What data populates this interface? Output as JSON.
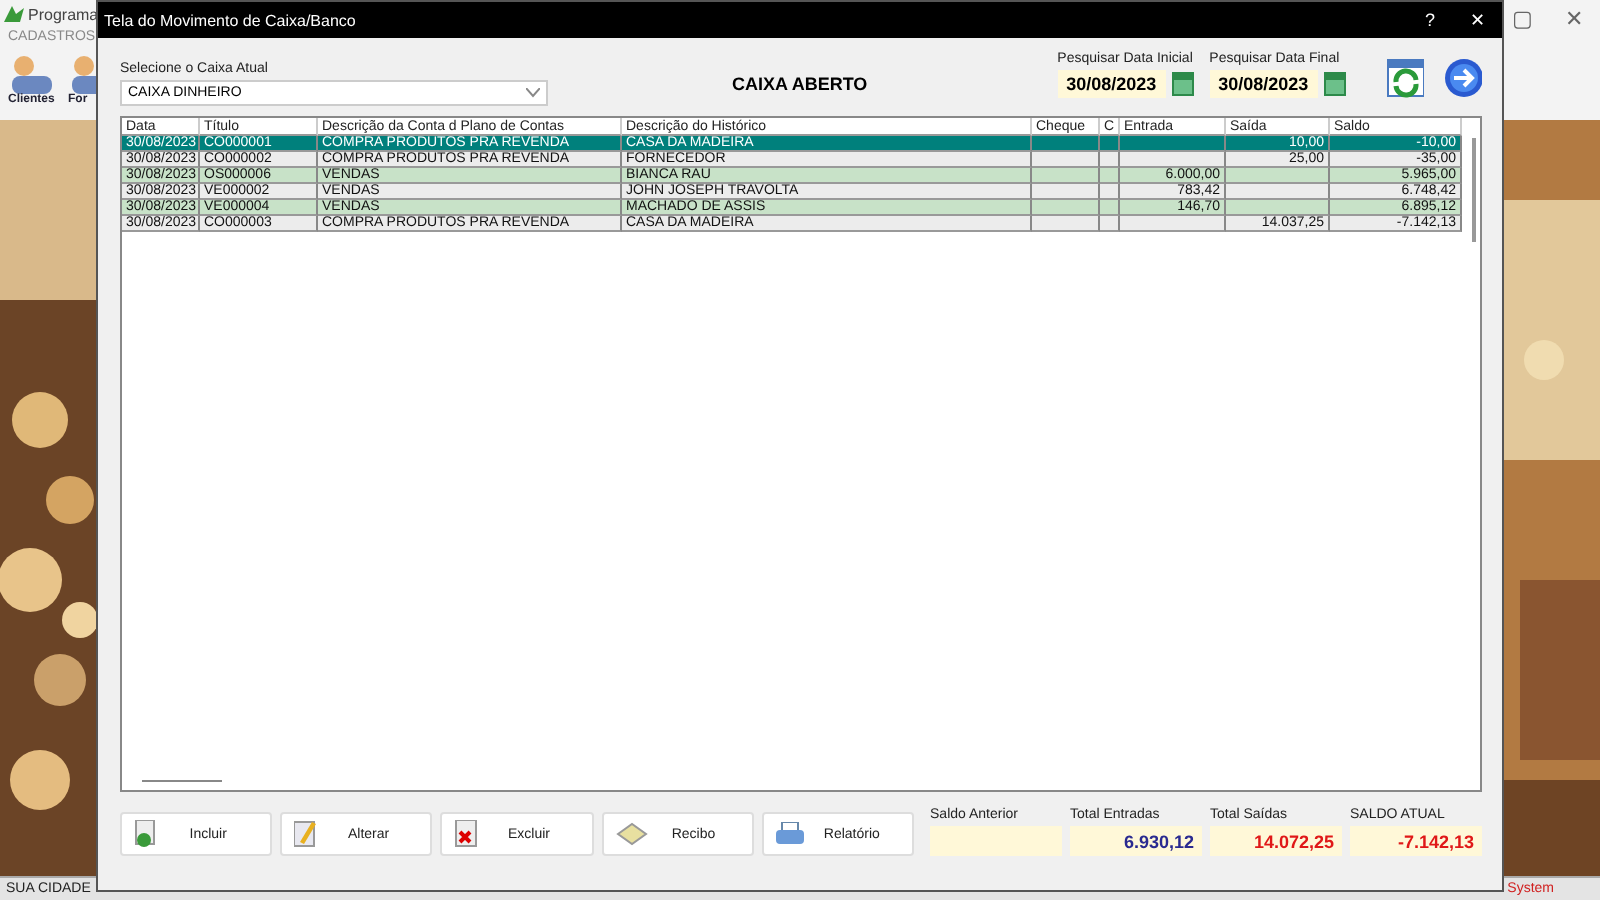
{
  "background_app": {
    "title": "Programa",
    "menu": "CADASTROS",
    "toolbar": [
      {
        "label": "Clientes"
      },
      {
        "label": "For"
      }
    ],
    "controls": [
      "▢",
      "✕"
    ],
    "status_left": "SUA CIDADE",
    "status_right": "System"
  },
  "dialog": {
    "title": "Tela do Movimento de Caixa/Banco",
    "help": "?",
    "close": "✕"
  },
  "caixa": {
    "label": "Selecione o Caixa Atual",
    "value": "CAIXA DINHEIRO"
  },
  "status_title": "CAIXA ABERTO",
  "date_start": {
    "label": "Pesquisar Data Inicial",
    "value": "30/08/2023"
  },
  "date_end": {
    "label": "Pesquisar Data Final",
    "value": "30/08/2023"
  },
  "table": {
    "columns": [
      "Data",
      "Título",
      "Descrição da Conta d Plano de Contas",
      "Descrição do Histórico",
      "Cheque",
      "C",
      "Entrada",
      "Saída",
      "Saldo"
    ],
    "rows": [
      {
        "selected": true,
        "cells": [
          "30/08/2023",
          "CO000001",
          "COMPRA PRODUTOS PRA REVENDA",
          "CASA DA MADEIRA",
          "",
          "",
          "",
          "10,00",
          "-10,00"
        ]
      },
      {
        "selected": false,
        "cells": [
          "30/08/2023",
          "CO000002",
          "COMPRA PRODUTOS PRA REVENDA",
          "FORNECEDOR",
          "",
          "",
          "",
          "25,00",
          "-35,00"
        ]
      },
      {
        "selected": false,
        "cells": [
          "30/08/2023",
          "OS000006",
          "VENDAS",
          "BIANCA RAU",
          "",
          "",
          "6.000,00",
          "",
          "5.965,00"
        ]
      },
      {
        "selected": false,
        "cells": [
          "30/08/2023",
          "VE000002",
          "VENDAS",
          "JOHN JOSEPH TRAVOLTA",
          "",
          "",
          "783,42",
          "",
          "6.748,42"
        ]
      },
      {
        "selected": false,
        "cells": [
          "30/08/2023",
          "VE000004",
          "VENDAS",
          "MACHADO DE ASSIS",
          "",
          "",
          "146,70",
          "",
          "6.895,12"
        ]
      },
      {
        "selected": false,
        "cells": [
          "30/08/2023",
          "CO000003",
          "COMPRA PRODUTOS PRA REVENDA",
          "CASA DA MADEIRA",
          "",
          "",
          "",
          "14.037,25",
          "-7.142,13"
        ]
      }
    ]
  },
  "buttons": [
    {
      "kind": "add",
      "label": "Incluir"
    },
    {
      "kind": "edit",
      "label": "Alterar"
    },
    {
      "kind": "delete",
      "label": "Excluir"
    },
    {
      "kind": "receipt",
      "label": "Recibo"
    },
    {
      "kind": "print",
      "label": "Relatório"
    }
  ],
  "totals": [
    {
      "label": "Saldo Anterior"
    },
    {
      "label": "Total Entradas",
      "value": "6.930,12",
      "color": "#2a2a90"
    },
    {
      "label": "Total Saídas",
      "value": "14.072,25",
      "color": "#e01818"
    },
    {
      "label": "SALDO ATUAL",
      "value": "-7.142,13",
      "color": "#e01818"
    }
  ]
}
